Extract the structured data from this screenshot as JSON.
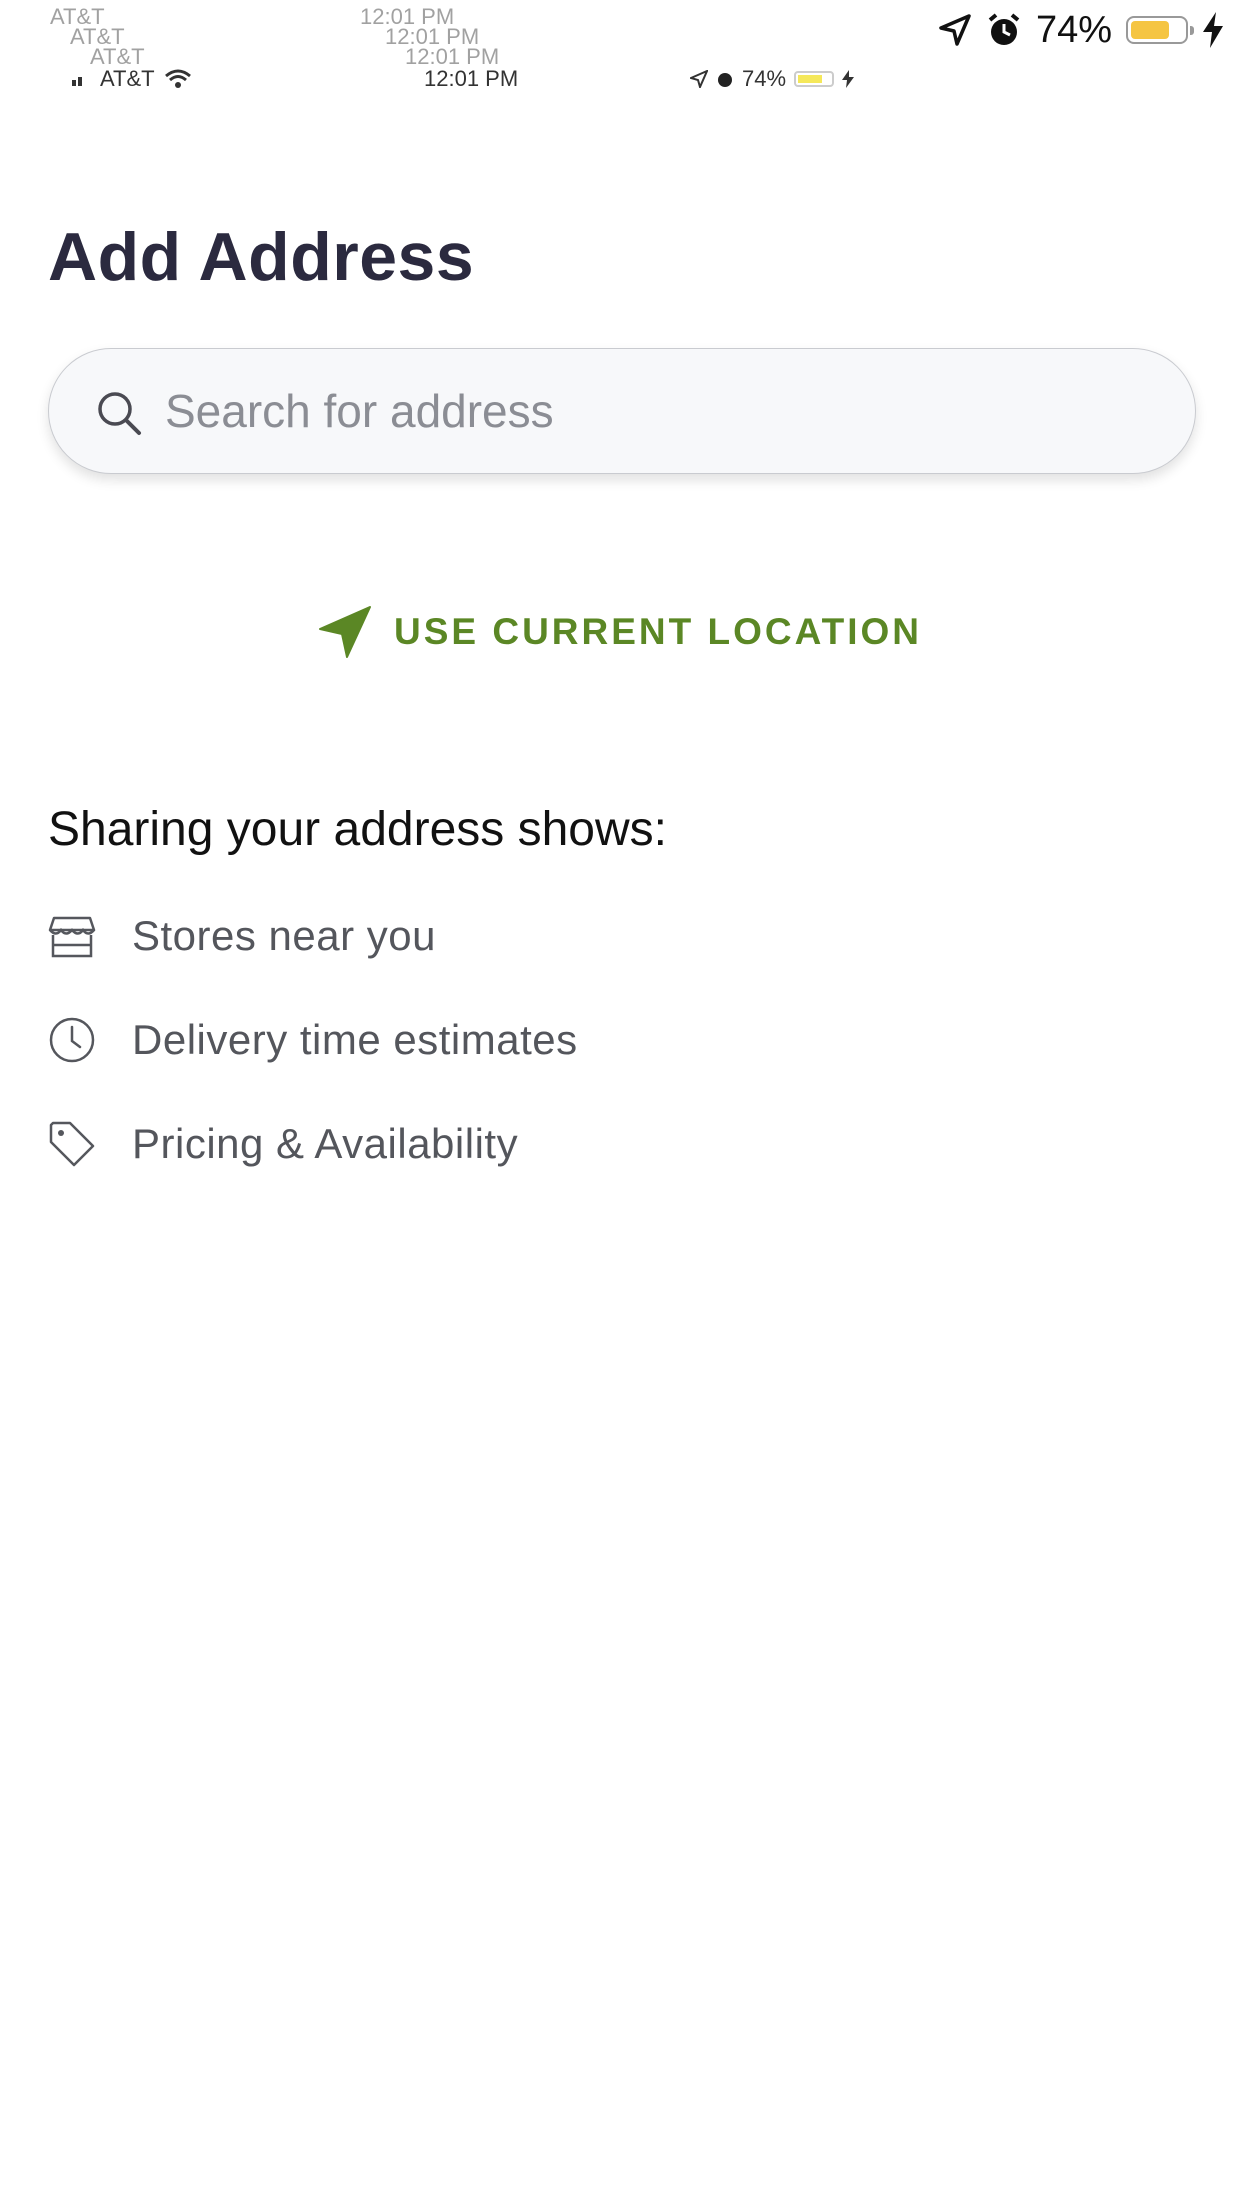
{
  "status_bar": {
    "carrier": "AT&T",
    "time": "12:01 PM",
    "battery_percent": "74%",
    "battery_level": 0.74,
    "battery_color": "#f5c542"
  },
  "page": {
    "title": "Add Address"
  },
  "search": {
    "placeholder": "Search for address",
    "value": "",
    "icon": "search-icon"
  },
  "location_button": {
    "label": "USE CURRENT LOCATION",
    "icon": "location-arrow-icon",
    "color": "#5b8725"
  },
  "info": {
    "heading": "Sharing your address shows:",
    "items": [
      {
        "icon": "store-icon",
        "label": "Stores near you"
      },
      {
        "icon": "clock-icon",
        "label": "Delivery time estimates"
      },
      {
        "icon": "price-tag-icon",
        "label": "Pricing & Availability"
      }
    ]
  },
  "colors": {
    "title": "#2b2a3f",
    "accent_green": "#5b8725",
    "muted_text": "#54565c"
  }
}
